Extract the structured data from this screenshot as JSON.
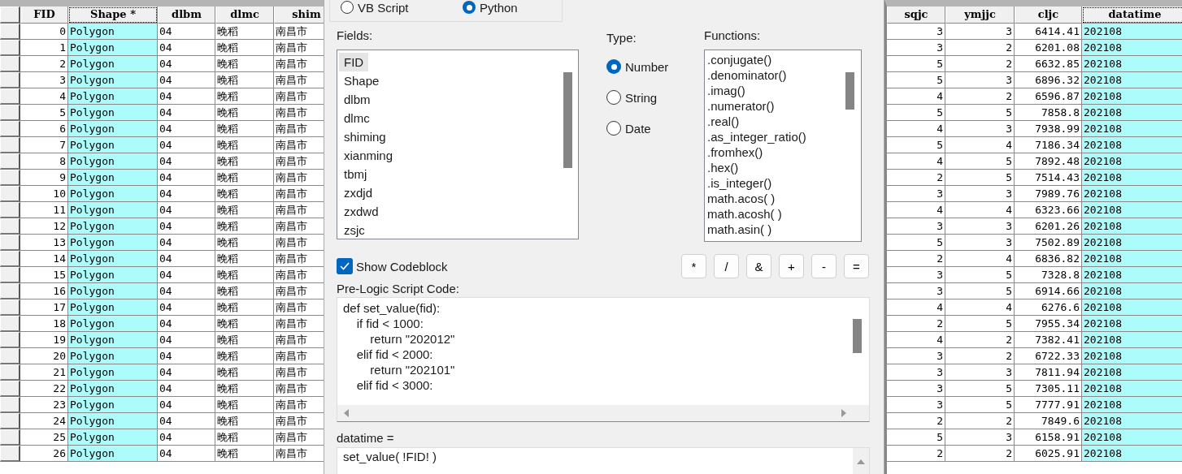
{
  "left_table": {
    "columns": [
      {
        "label": "FID",
        "numeric": true,
        "selected": false
      },
      {
        "label": "Shape *",
        "numeric": false,
        "selected": true
      },
      {
        "label": "dlbm",
        "numeric": false,
        "selected": false
      },
      {
        "label": "dlmc",
        "numeric": false,
        "selected": false
      },
      {
        "label": "shim",
        "numeric": false,
        "selected": false
      }
    ],
    "rows": [
      [
        "0",
        "Polygon",
        "04",
        "晚稻",
        "南昌市"
      ],
      [
        "1",
        "Polygon",
        "04",
        "晚稻",
        "南昌市"
      ],
      [
        "2",
        "Polygon",
        "04",
        "晚稻",
        "南昌市"
      ],
      [
        "3",
        "Polygon",
        "04",
        "晚稻",
        "南昌市"
      ],
      [
        "4",
        "Polygon",
        "04",
        "晚稻",
        "南昌市"
      ],
      [
        "5",
        "Polygon",
        "04",
        "晚稻",
        "南昌市"
      ],
      [
        "6",
        "Polygon",
        "04",
        "晚稻",
        "南昌市"
      ],
      [
        "7",
        "Polygon",
        "04",
        "晚稻",
        "南昌市"
      ],
      [
        "8",
        "Polygon",
        "04",
        "晚稻",
        "南昌市"
      ],
      [
        "9",
        "Polygon",
        "04",
        "晚稻",
        "南昌市"
      ],
      [
        "10",
        "Polygon",
        "04",
        "晚稻",
        "南昌市"
      ],
      [
        "11",
        "Polygon",
        "04",
        "晚稻",
        "南昌市"
      ],
      [
        "12",
        "Polygon",
        "04",
        "晚稻",
        "南昌市"
      ],
      [
        "13",
        "Polygon",
        "04",
        "晚稻",
        "南昌市"
      ],
      [
        "14",
        "Polygon",
        "04",
        "晚稻",
        "南昌市"
      ],
      [
        "15",
        "Polygon",
        "04",
        "晚稻",
        "南昌市"
      ],
      [
        "16",
        "Polygon",
        "04",
        "晚稻",
        "南昌市"
      ],
      [
        "17",
        "Polygon",
        "04",
        "晚稻",
        "南昌市"
      ],
      [
        "18",
        "Polygon",
        "04",
        "晚稻",
        "南昌市"
      ],
      [
        "19",
        "Polygon",
        "04",
        "晚稻",
        "南昌市"
      ],
      [
        "20",
        "Polygon",
        "04",
        "晚稻",
        "南昌市"
      ],
      [
        "21",
        "Polygon",
        "04",
        "晚稻",
        "南昌市"
      ],
      [
        "22",
        "Polygon",
        "04",
        "晚稻",
        "南昌市"
      ],
      [
        "23",
        "Polygon",
        "04",
        "晚稻",
        "南昌市"
      ],
      [
        "24",
        "Polygon",
        "04",
        "晚稻",
        "南昌市"
      ],
      [
        "25",
        "Polygon",
        "04",
        "晚稻",
        "南昌市"
      ],
      [
        "26",
        "Polygon",
        "04",
        "晚稻",
        "南昌市"
      ]
    ]
  },
  "dialog": {
    "parser_options": [
      {
        "label": "VB Script",
        "selected": false
      },
      {
        "label": "Python",
        "selected": true
      }
    ],
    "fields_label": "Fields:",
    "fields": [
      {
        "label": "FID",
        "selected": true
      },
      {
        "label": "Shape",
        "selected": false
      },
      {
        "label": "dlbm",
        "selected": false
      },
      {
        "label": "dlmc",
        "selected": false
      },
      {
        "label": "shiming",
        "selected": false
      },
      {
        "label": "xianming",
        "selected": false
      },
      {
        "label": "tbmj",
        "selected": false
      },
      {
        "label": "zxdjd",
        "selected": false
      },
      {
        "label": "zxdwd",
        "selected": false
      },
      {
        "label": "zsjc",
        "selected": false
      }
    ],
    "type_label": "Type:",
    "types": [
      {
        "label": "Number",
        "selected": true
      },
      {
        "label": "String",
        "selected": false
      },
      {
        "label": "Date",
        "selected": false
      }
    ],
    "functions_label": "Functions:",
    "functions": [
      ".conjugate()",
      ".denominator()",
      ".imag()",
      ".numerator()",
      ".real()",
      ".as_integer_ratio()",
      ".fromhex()",
      ".hex()",
      ".is_integer()",
      "math.acos( )",
      "math.acosh( )",
      "math.asin( )"
    ],
    "show_codeblock": {
      "label": "Show Codeblock",
      "checked": true
    },
    "operators": [
      "*",
      "/",
      "&",
      "+",
      "-",
      "="
    ],
    "prelogic_label": "Pre-Logic Script Code:",
    "prelogic_code": [
      "def set_value(fid):",
      "    if fid < 1000:",
      "        return \"202012\"",
      "    elif fid < 2000:",
      "        return \"202101\"",
      "    elif fid < 3000:"
    ],
    "expression_label": "datatime =",
    "expression": "set_value( !FID! )"
  },
  "right_table": {
    "columns": [
      {
        "label": "sqjc",
        "numeric": true,
        "selected": false
      },
      {
        "label": "ymjjc",
        "numeric": true,
        "selected": false
      },
      {
        "label": "cljc",
        "numeric": true,
        "selected": false
      },
      {
        "label": "datatime",
        "numeric": false,
        "selected": true
      }
    ],
    "rows": [
      [
        "3",
        "3",
        "6414.41",
        "202108"
      ],
      [
        "3",
        "2",
        "6201.08",
        "202108"
      ],
      [
        "5",
        "2",
        "6632.85",
        "202108"
      ],
      [
        "5",
        "3",
        "6896.32",
        "202108"
      ],
      [
        "4",
        "2",
        "6596.87",
        "202108"
      ],
      [
        "5",
        "5",
        "7858.8",
        "202108"
      ],
      [
        "4",
        "3",
        "7938.99",
        "202108"
      ],
      [
        "5",
        "4",
        "7186.34",
        "202108"
      ],
      [
        "4",
        "5",
        "7892.48",
        "202108"
      ],
      [
        "2",
        "5",
        "7514.43",
        "202108"
      ],
      [
        "3",
        "3",
        "7989.76",
        "202108"
      ],
      [
        "4",
        "4",
        "6323.66",
        "202108"
      ],
      [
        "3",
        "3",
        "6201.26",
        "202108"
      ],
      [
        "5",
        "3",
        "7502.89",
        "202108"
      ],
      [
        "2",
        "4",
        "6836.82",
        "202108"
      ],
      [
        "3",
        "5",
        "7328.8",
        "202108"
      ],
      [
        "3",
        "5",
        "6914.66",
        "202108"
      ],
      [
        "4",
        "4",
        "6276.6",
        "202108"
      ],
      [
        "2",
        "5",
        "7955.34",
        "202108"
      ],
      [
        "4",
        "2",
        "7382.41",
        "202108"
      ],
      [
        "3",
        "2",
        "6722.33",
        "202108"
      ],
      [
        "3",
        "3",
        "7811.94",
        "202108"
      ],
      [
        "3",
        "5",
        "7305.11",
        "202108"
      ],
      [
        "3",
        "5",
        "7777.91",
        "202108"
      ],
      [
        "2",
        "2",
        "7849.6",
        "202108"
      ],
      [
        "5",
        "3",
        "6158.91",
        "202108"
      ],
      [
        "2",
        "2",
        "6025.91",
        "202108"
      ]
    ]
  }
}
